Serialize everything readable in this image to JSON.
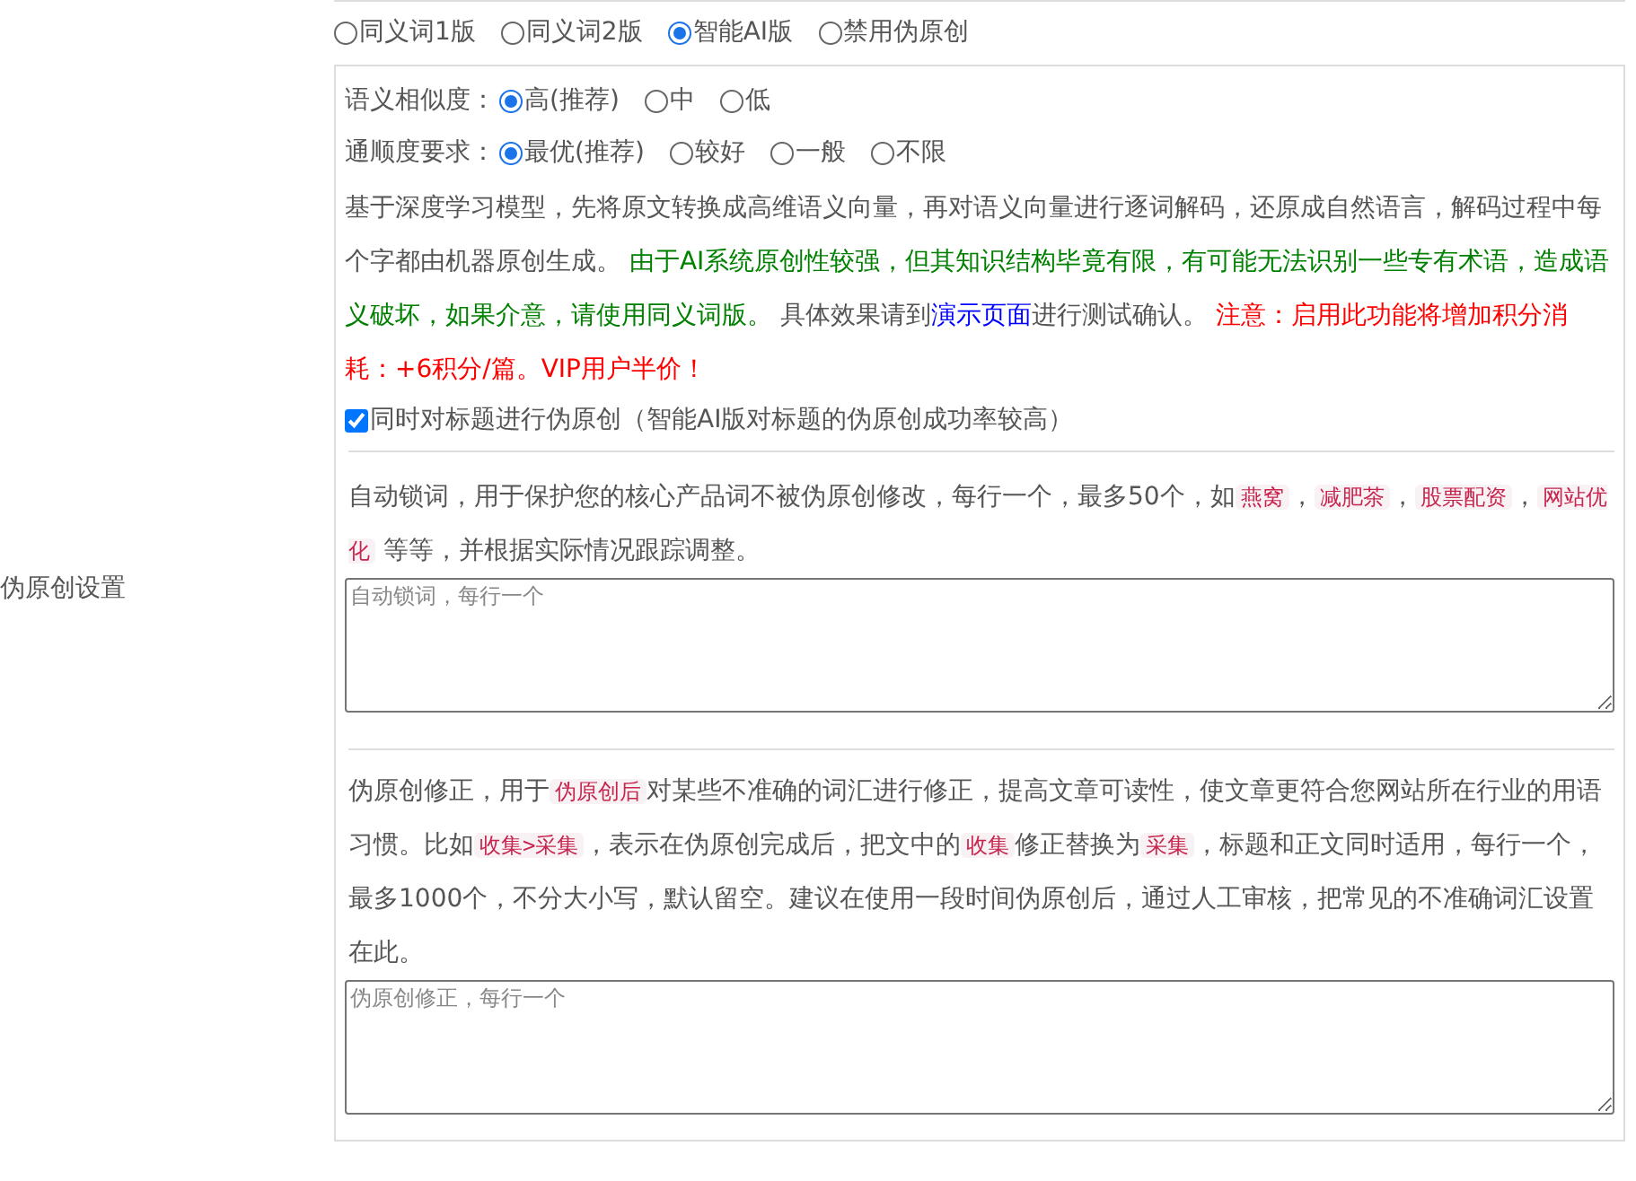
{
  "left_label": "伪原创设置",
  "mode_options": [
    {
      "label": "同义词1版",
      "selected": false
    },
    {
      "label": "同义词2版",
      "selected": false
    },
    {
      "label": "智能AI版",
      "selected": true
    },
    {
      "label": "禁用伪原创",
      "selected": false
    }
  ],
  "similarity": {
    "label": "语义相似度：",
    "options": [
      {
        "label": "高(推荐)",
        "selected": true
      },
      {
        "label": "中",
        "selected": false
      },
      {
        "label": "低",
        "selected": false
      }
    ]
  },
  "fluency": {
    "label": "通顺度要求：",
    "options": [
      {
        "label": "最优(推荐)",
        "selected": true
      },
      {
        "label": "较好",
        "selected": false
      },
      {
        "label": "一般",
        "selected": false
      },
      {
        "label": "不限",
        "selected": false
      }
    ]
  },
  "description": [
    {
      "kind": "plain",
      "text": "基于深度学习模型，先将原文转换成高维语义向量，再对语义向量进行逐词解码，还原成自然语言，解码过程中每个字都由机器原创生成。 "
    },
    {
      "kind": "notice",
      "text": "由于AI系统原创性较强，但其知识结构毕竟有限，有可能无法识别一些专有术语，造成语义破坏，如果介意，请使用同义词版。"
    },
    {
      "kind": "plain",
      "text": " 具体效果请到"
    },
    {
      "kind": "link",
      "text": "演示页面"
    },
    {
      "kind": "plain",
      "text": "进行测试确认。 "
    },
    {
      "kind": "alert",
      "text": "注意：启用此功能将增加积分消耗：+6积分/篇。VIP用户半价！"
    }
  ],
  "title_option": {
    "label": "同时对标题进行伪原创（智能AI版对标题的伪原创成功率较高）",
    "checked": true
  },
  "lock_words": {
    "description": [
      {
        "kind": "plain",
        "text": "自动锁词，用于保护您的核心产品词不被伪原创修改，每行一个，最多50个，如"
      },
      {
        "kind": "code",
        "text": "燕窝"
      },
      {
        "kind": "plain",
        "text": "，"
      },
      {
        "kind": "code",
        "text": "减肥茶"
      },
      {
        "kind": "plain",
        "text": "，"
      },
      {
        "kind": "code",
        "text": "股票配资"
      },
      {
        "kind": "plain",
        "text": "，"
      },
      {
        "kind": "code",
        "text": "网站优化"
      },
      {
        "kind": "plain",
        "text": " 等等，并根据实际情况跟踪调整。"
      }
    ],
    "placeholder": "自动锁词，每行一个"
  },
  "corrections": {
    "description": [
      {
        "kind": "plain",
        "text": "伪原创修正，用于"
      },
      {
        "kind": "code",
        "text": "伪原创后"
      },
      {
        "kind": "plain",
        "text": "对某些不准确的词汇进行修正，提高文章可读性，使文章更符合您网站所在行业的用语习惯。比如"
      },
      {
        "kind": "code",
        "text": "收集>采集"
      },
      {
        "kind": "plain",
        "text": "，表示在伪原创完成后，把文中的"
      },
      {
        "kind": "code",
        "text": "收集"
      },
      {
        "kind": "plain",
        "text": "修正替换为"
      },
      {
        "kind": "code",
        "text": "采集"
      },
      {
        "kind": "plain",
        "text": "，标题和正文同时适用，每行一个，最多1000个，不分大小写，默认留空。建议在使用一段时间伪原创后，通过人工审核，把常见的不准确词汇设置在此。"
      }
    ],
    "placeholder": "伪原创修正，每行一个"
  }
}
